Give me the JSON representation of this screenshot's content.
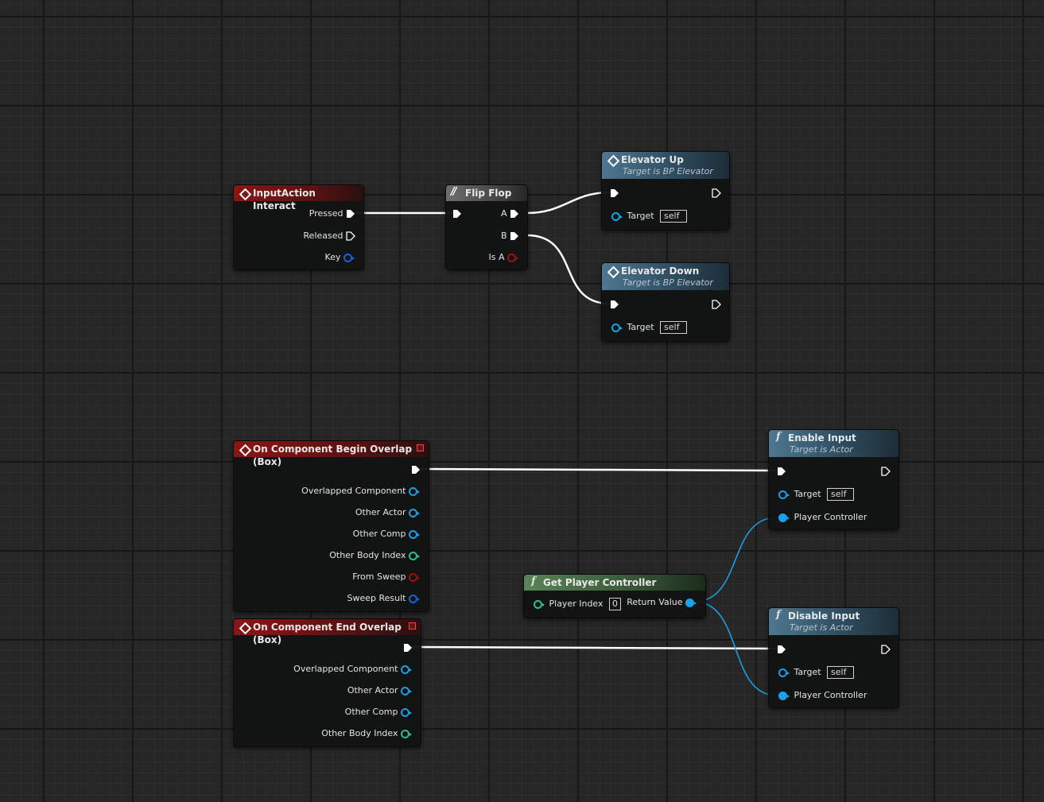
{
  "nodes": {
    "input_action": {
      "title": "InputAction Interact",
      "pins": {
        "pressed": "Pressed",
        "released": "Released",
        "key": "Key"
      }
    },
    "flip_flop": {
      "title": "Flip Flop",
      "pins": {
        "a": "A",
        "b": "B",
        "is_a": "Is A"
      }
    },
    "elevator_up": {
      "title": "Elevator Up",
      "subtitle": "Target is BP Elevator",
      "target_label": "Target",
      "target_value": "self"
    },
    "elevator_down": {
      "title": "Elevator Down",
      "subtitle": "Target is BP Elevator",
      "target_label": "Target",
      "target_value": "self"
    },
    "begin_overlap": {
      "title": "On Component Begin Overlap (Box)",
      "pins": [
        "Overlapped Component",
        "Other Actor",
        "Other Comp",
        "Other Body Index",
        "From Sweep",
        "Sweep Result"
      ]
    },
    "end_overlap": {
      "title": "On Component End Overlap (Box)",
      "pins": [
        "Overlapped Component",
        "Other Actor",
        "Other Comp",
        "Other Body Index"
      ]
    },
    "get_player_controller": {
      "title": "Get Player Controller",
      "player_index_label": "Player Index",
      "player_index_value": "0",
      "return_label": "Return Value"
    },
    "enable_input": {
      "title": "Enable Input",
      "subtitle": "Target is Actor",
      "target_label": "Target",
      "target_value": "self",
      "controller_label": "Player Controller"
    },
    "disable_input": {
      "title": "Disable Input",
      "subtitle": "Target is Actor",
      "target_label": "Target",
      "target_value": "self",
      "controller_label": "Player Controller"
    }
  },
  "colors": {
    "event_header": "#8a1616",
    "function_header": "#4e7790",
    "pure_header": "#5a8458",
    "macro_header": "#6e6e6e",
    "object_pin": "#1a9fe6",
    "int_pin": "#2fbf8a",
    "bool_pin": "#a01010",
    "exec_wire": "#ffffff",
    "object_wire": "#1a9fe6"
  },
  "icons": {
    "event": "event-diamond-icon",
    "function": "function-f-icon",
    "macro": "flipflop-macro-icon",
    "exec": "exec-arrow-icon",
    "delegate": "delegate-square-icon"
  }
}
